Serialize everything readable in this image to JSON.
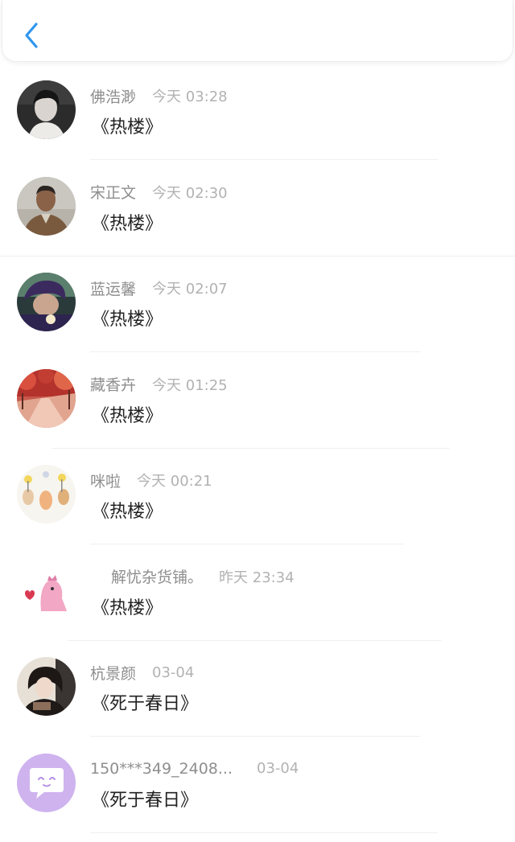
{
  "header": {
    "back_icon": "chevron-left-icon",
    "accent_color": "#2f96f0"
  },
  "items": [
    {
      "name": "佛浩渺",
      "time": "今天 03:28",
      "title": "《热楼》"
    },
    {
      "name": "宋正文",
      "time": "今天 02:30",
      "title": "《热楼》"
    },
    {
      "name": "蓝运馨",
      "time": "今天 02:07",
      "title": "《热楼》"
    },
    {
      "name": "藏香卉",
      "time": "今天 01:25",
      "title": "《热楼》"
    },
    {
      "name": "咪啦",
      "time": "今天 00:21",
      "title": "《热楼》"
    },
    {
      "name": "解忧杂货铺。",
      "time": "昨天 23:34",
      "title": "《热楼》"
    },
    {
      "name": "杭景颜",
      "time": "03-04",
      "title": "《死于春日》"
    },
    {
      "name": "150***349_2408...",
      "time": "03-04",
      "title": "《死于春日》"
    }
  ]
}
